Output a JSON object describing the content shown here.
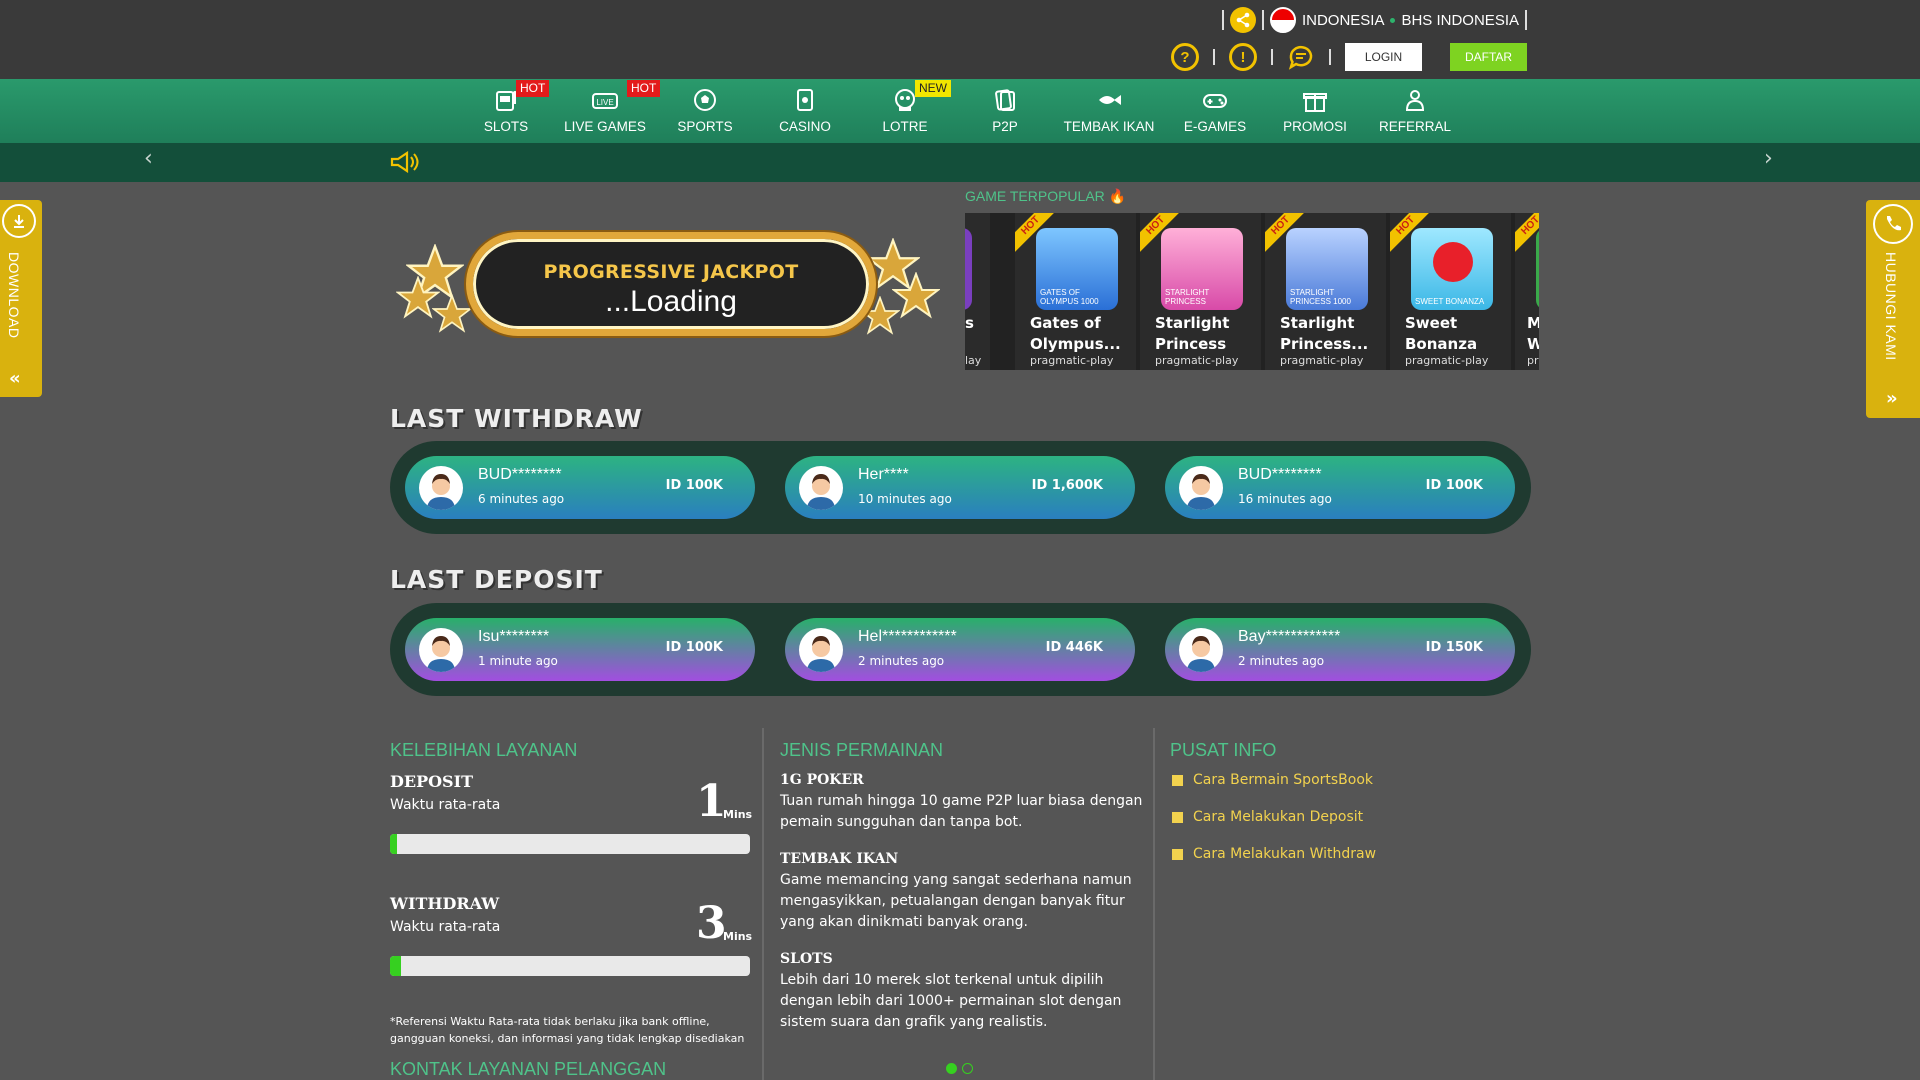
{
  "header": {
    "language": "INDONESIA",
    "language_alt": "BHS INDONESIA",
    "login_label": "LOGIN",
    "register_label": "DAFTAR"
  },
  "nav": [
    {
      "label": "SLOTS",
      "badge": "HOT",
      "icon": "slot-machine-icon"
    },
    {
      "label": "LIVE GAMES",
      "badge": "HOT",
      "icon": "live-icon"
    },
    {
      "label": "SPORTS",
      "badge": "",
      "icon": "soccer-ball-icon"
    },
    {
      "label": "CASINO",
      "badge": "",
      "icon": "cards-icon"
    },
    {
      "label": "LOTRE",
      "badge": "NEW",
      "icon": "lottery-icon"
    },
    {
      "label": "P2P",
      "badge": "",
      "icon": "p2p-cards-icon"
    },
    {
      "label": "TEMBAK IKAN",
      "badge": "",
      "icon": "fish-icon"
    },
    {
      "label": "E-GAMES",
      "badge": "",
      "icon": "gamepad-icon"
    },
    {
      "label": "PROMOSI",
      "badge": "",
      "icon": "gift-icon"
    },
    {
      "label": "REFERRAL",
      "badge": "",
      "icon": "referral-icon"
    }
  ],
  "side": {
    "download_label": "DOWNLOAD",
    "contact_label": "HUBUNGI KAMI"
  },
  "jackpot": {
    "title": "PROGRESSIVE JACKPOT",
    "value": "...Loading"
  },
  "popular": {
    "title": "GAME TERPOPULAR",
    "ribbon": "HOT",
    "partial_left": {
      "name": "s",
      "provider": "lay"
    },
    "games": [
      {
        "name": "Gates of Olympus...",
        "provider": "pragmatic-play",
        "thumb_text": "GATES OF OLYMPUS 1000",
        "color": "#2a6fd6"
      },
      {
        "name": "Starlight Princess",
        "provider": "pragmatic-play",
        "thumb_text": "STARLIGHT PRINCESS",
        "color": "#d84aa8"
      },
      {
        "name": "Starlight Princess...",
        "provider": "pragmatic-play",
        "thumb_text": "STARLIGHT PRINCESS 1000",
        "color": "#4a7ad8"
      },
      {
        "name": "Sweet Bonanza",
        "provider": "pragmatic-play",
        "thumb_text": "SWEET BONANZA",
        "color": "#3bb7e6"
      }
    ],
    "partial_right": {
      "name": "M W",
      "provider": "pr"
    }
  },
  "withdraw": {
    "title": "LAST WITHDRAW",
    "items": [
      {
        "name": "BUD********",
        "time": "6 minutes ago",
        "amount": "ID 100K"
      },
      {
        "name": "Her****",
        "time": "10 minutes ago",
        "amount": "ID 1,600K"
      },
      {
        "name": "BUD********",
        "time": "16 minutes ago",
        "amount": "ID 100K"
      }
    ]
  },
  "deposit": {
    "title": "LAST DEPOSIT",
    "items": [
      {
        "name": "Isu********",
        "time": "1 minute ago",
        "amount": "ID 100K"
      },
      {
        "name": "Hel************",
        "time": "2 minutes ago",
        "amount": "ID 446K"
      },
      {
        "name": "Bay************",
        "time": "2 minutes ago",
        "amount": "ID 150K"
      }
    ]
  },
  "service": {
    "title": "KELEBIHAN LAYANAN",
    "deposit_label": "DEPOSIT",
    "deposit_sub": "Waktu rata-rata",
    "deposit_value": "1",
    "deposit_unit": "Mins",
    "deposit_progress": 0.02,
    "withdraw_label": "WITHDRAW",
    "withdraw_sub": "Waktu rata-rata",
    "withdraw_value": "3",
    "withdraw_unit": "Mins",
    "withdraw_progress": 0.03,
    "note": "*Referensi Waktu Rata-rata tidak berlaku jika bank offline, gangguan koneksi, dan informasi yang tidak lengkap disediakan",
    "contact_title": "KONTAK LAYANAN PELANGGAN"
  },
  "games_info": {
    "title": "JENIS PERMAINAN",
    "items": [
      {
        "heading": "1G POKER",
        "text": "Tuan rumah hingga 10 game P2P luar biasa dengan pemain sungguhan dan tanpa bot."
      },
      {
        "heading": "TEMBAK IKAN",
        "text": "Game memancing yang sangat sederhana namun mengasyikkan, petualangan dengan banyak fitur yang akan dinikmati banyak orang."
      },
      {
        "heading": "SLOTS",
        "text": "Lebih dari 10 merek slot terkenal untuk dipilih dengan lebih dari 1000+ permainan slot dengan sistem suara dan grafik yang realistis."
      }
    ]
  },
  "info_center": {
    "title": "PUSAT INFO",
    "links": [
      "Cara Bermain SportsBook",
      "Cara Melakukan Deposit",
      "Cara Melakukan Withdraw"
    ]
  },
  "colors": {
    "accent_green": "#4fc38a",
    "nav_green": "#258a62",
    "gold": "#d9b20e",
    "link_yellow": "#f2d24e"
  }
}
